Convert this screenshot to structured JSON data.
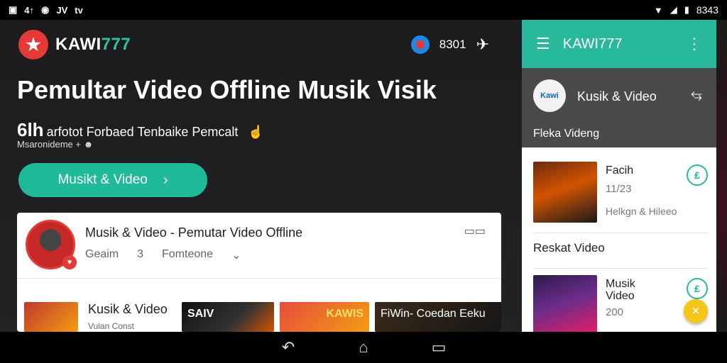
{
  "status_bar": {
    "left_icons": [
      "image-icon",
      "signal-text-icon",
      "circle-app-icon",
      "news-icon",
      "tv-icon"
    ],
    "left_texts": [
      "4↑",
      "JV",
      "tv"
    ],
    "time": "8343"
  },
  "header": {
    "brand": "KAWI777",
    "brand_prefix": "KAWI",
    "brand_suffix": "777",
    "count": "8301"
  },
  "hero": {
    "headline": "Pemultar Video Offline Musik Visik",
    "sub_big": "6lh",
    "sub_text": "arfotot Forbaed Tenbaike Pemcalt  ",
    "meta": "Msaronideme +",
    "cta_label": "Musikt & Video"
  },
  "card": {
    "title": "Musik & Video - Pemutar Video Offline",
    "sub_left": "Geaim",
    "sub_num": "3",
    "sub_right": "Fomteone",
    "thumbs": [
      {
        "title": "Kusik & Video",
        "sub": "Vulan Const"
      },
      {
        "label": "SAIV"
      },
      {
        "label": "KAWIS"
      },
      {
        "label": "FiWin- Coedan Eeku"
      }
    ]
  },
  "panel": {
    "bar_title": "KAWI777",
    "channel_name": "Kusik & Video",
    "logo_text": "Kawi",
    "section_label": "Fleka Videng",
    "items": [
      {
        "title": "Facih",
        "meta": "11/23",
        "sub": "Helkgn & Hileeo"
      },
      {
        "title": "Musik\nVideo",
        "meta": "200",
        "sub": ""
      }
    ],
    "recent_label": "Reskat Video"
  },
  "colors": {
    "accent": "#27b99a",
    "cta": "#1fba98",
    "brand_red": "#e53935",
    "fab": "#f5c518"
  }
}
